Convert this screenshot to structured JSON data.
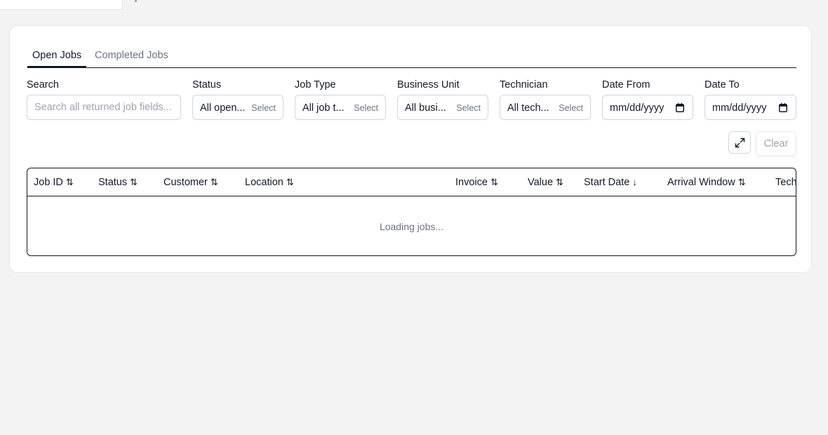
{
  "tabs": [
    {
      "label": "Open Jobs"
    },
    {
      "label": "Completed Jobs"
    }
  ],
  "filters": {
    "search": {
      "label": "Search",
      "placeholder": "Search all returned job fields...",
      "value": ""
    },
    "status": {
      "label": "Status",
      "value": "All open...",
      "hint": "Select"
    },
    "job_type": {
      "label": "Job Type",
      "value": "All job t...",
      "hint": "Select"
    },
    "business_unit": {
      "label": "Business Unit",
      "value": "All busi...",
      "hint": "Select"
    },
    "technician": {
      "label": "Technician",
      "value": "All tech...",
      "hint": "Select"
    },
    "date_from": {
      "label": "Date From",
      "value": "mm/dd/yyyy"
    },
    "date_to": {
      "label": "Date To",
      "value": "mm/dd/yyyy"
    }
  },
  "actions": {
    "clear_label": "Clear",
    "expand_icon": "expand-arrows-icon"
  },
  "table": {
    "columns": [
      {
        "label": "Job ID",
        "sort": "⇅"
      },
      {
        "label": "Status",
        "sort": "⇅"
      },
      {
        "label": "Customer",
        "sort": "⇅"
      },
      {
        "label": "Location",
        "sort": "⇅"
      },
      {
        "label": "Invoice",
        "sort": "⇅"
      },
      {
        "label": "Value",
        "sort": "⇅"
      },
      {
        "label": "Start Date",
        "sort": "↓"
      },
      {
        "label": "Arrival Window",
        "sort": "⇅"
      },
      {
        "label": "Tech",
        "sort": ""
      }
    ],
    "loading_text": "Loading jobs..."
  }
}
